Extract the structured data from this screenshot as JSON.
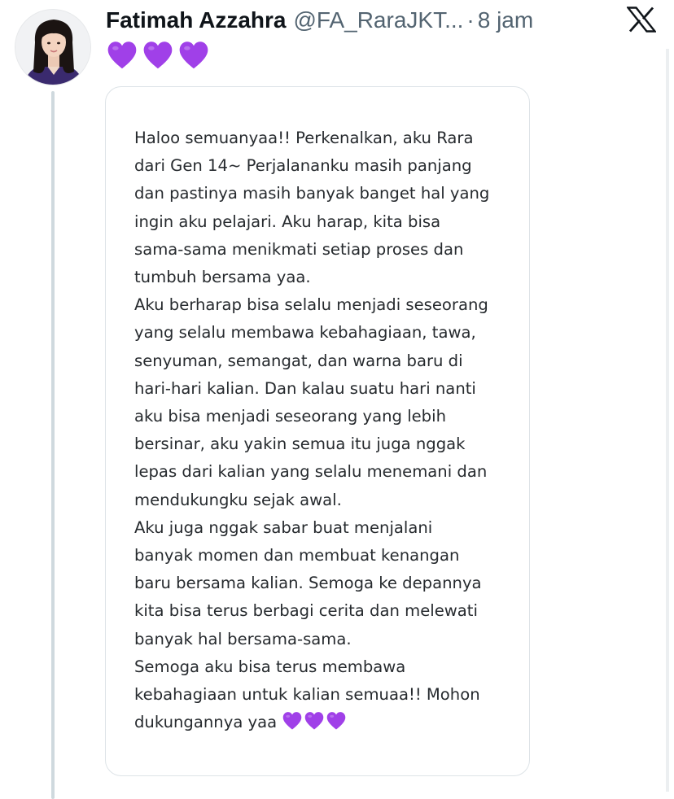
{
  "tweet": {
    "display_name": "Fatimah Azzahra",
    "handle": "@FA_RaraJKT...",
    "separator": "·",
    "time": "8 jam",
    "hearts_count": 3,
    "heart_icon": "purple-heart-icon",
    "heart_color": "#a040e8"
  },
  "platform": {
    "logo_icon": "x-logo-icon"
  },
  "card": {
    "lines": [
      "Haloo semuanyaa!! Perkenalkan, aku Rara",
      "dari Gen 14~ Perjalananku masih panjang",
      "dan pastinya masih banyak banget hal yang",
      "ingin aku pelajari. Aku harap, kita bisa",
      "sama-sama menikmati setiap proses dan",
      "tumbuh bersama yaa.",
      "Aku berharap bisa selalu menjadi seseorang",
      "yang selalu membawa kebahagiaan, tawa,",
      "senyuman, semangat, dan warna baru di",
      "hari-hari kalian. Dan kalau suatu hari nanti",
      "aku bisa menjadi seseorang yang lebih",
      "bersinar, aku yakin semua itu juga nggak",
      "lepas dari kalian yang selalu menemani dan",
      "mendukungku sejak awal.",
      "Aku juga nggak sabar buat menjalani",
      "banyak momen dan membuat kenangan",
      "baru bersama kalian. Semoga ke depannya",
      "kita bisa terus berbagi cerita dan melewati",
      "banyak hal bersama-sama.",
      "Semoga aku bisa terus membawa",
      "kebahagiaan untuk kalian semuaa!! Mohon"
    ],
    "last_line": "dukungannya yaa",
    "last_line_hearts": 3
  }
}
